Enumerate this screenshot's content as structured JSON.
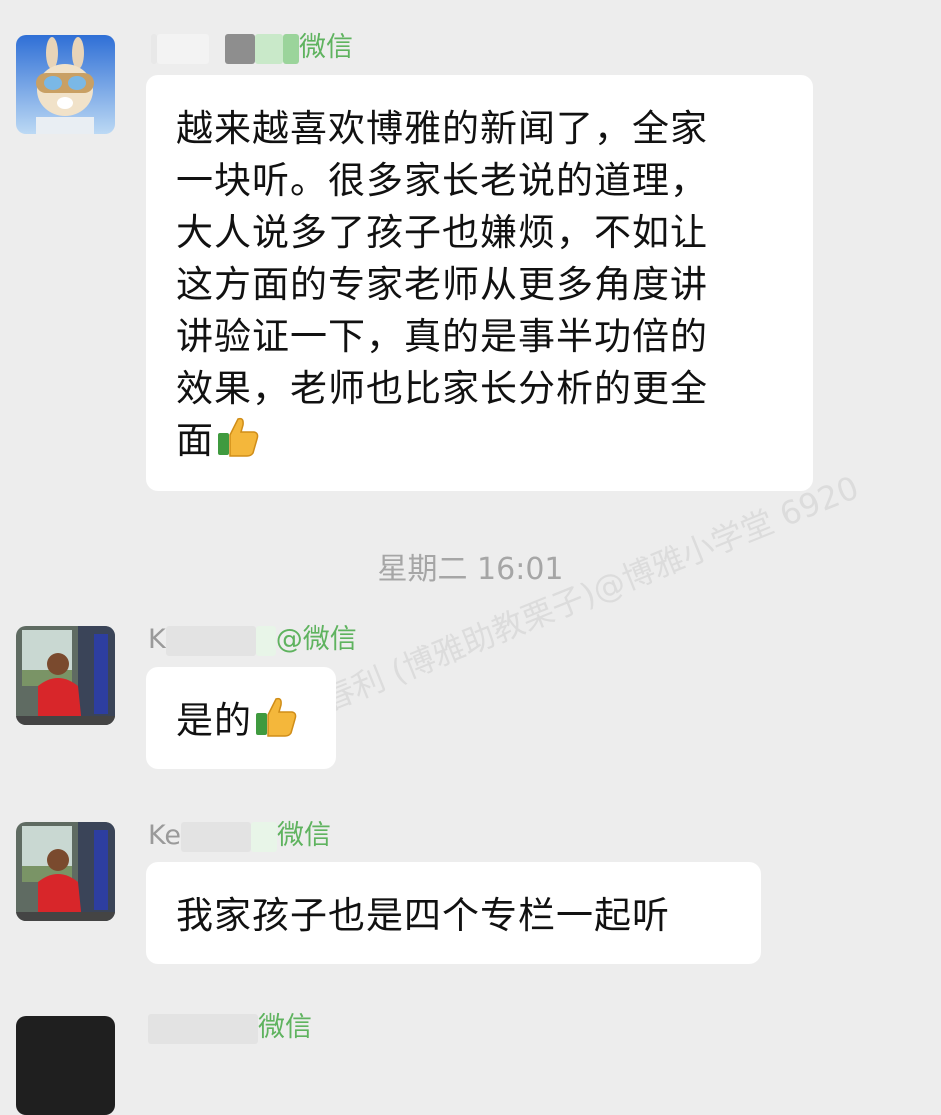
{
  "watermark": "陈春利 (博雅助教栗子)@博雅小学堂 6920",
  "messages": [
    {
      "sender_suffix": "微信",
      "text_lines": [
        "越来越喜欢博雅的新闻了，全家",
        "一块听。很多家长老说的道理，",
        "大人说多了孩子也嫌烦，不如让",
        "这方面的专家老师从更多角度讲",
        "讲验证一下，真的是事半功倍的",
        "效果，老师也比家长分析的更全",
        "面"
      ],
      "emoji": "thumbs-up"
    },
    {
      "sender_prefix": "K",
      "sender_suffix": "@微信",
      "text": "是的",
      "emoji": "thumbs-up"
    },
    {
      "sender_prefix": "Ke",
      "sender_suffix": "微信",
      "text": "我家孩子也是四个专栏一起听"
    },
    {
      "sender_suffix": "微信"
    }
  ],
  "timestamp": "星期二 16:01",
  "colors": {
    "background": "#ededed",
    "bubble": "#ffffff",
    "wechat_green": "#5fb35f",
    "timestamp": "#a6a6a6"
  }
}
